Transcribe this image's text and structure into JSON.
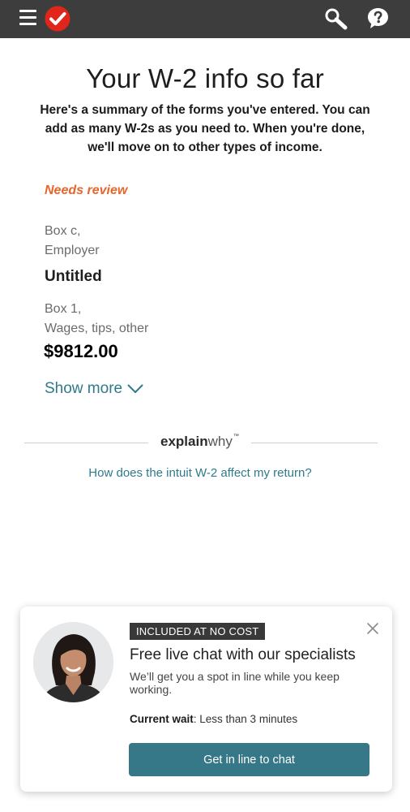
{
  "header": {
    "menu_icon": "hamburger-icon",
    "logo_icon": "checkmark-logo-icon",
    "search_icon": "search-icon",
    "help_icon": "help-question-icon",
    "brand_color": "#e1251b",
    "bar_color": "#3d3d3d"
  },
  "page": {
    "title": "Your W-2 info so far",
    "subtitle": "Here's a summary of the forms you've entered. You can add as many W-2s as you need to. When you're done, we'll move on to other types of income."
  },
  "w2": {
    "status": "Needs review",
    "employer_label_line1": "Box c,",
    "employer_label_line2": "Employer",
    "employer_value": "Untitled",
    "wages_label_line1": "Box 1,",
    "wages_label_line2": "Wages, tips, other",
    "wages_value": "$9812.00",
    "show_more": "Show more",
    "status_color": "#e8652b",
    "link_color": "#2f7a8c"
  },
  "explain": {
    "logo_bold": "explain",
    "logo_light": "why",
    "logo_mark": "™",
    "link": "How does the intuit W-2 affect my return?"
  },
  "chat": {
    "badge": "INCLUDED AT NO COST",
    "title": "Free live chat with our specialists",
    "description": "We’ll get you a spot in line while you keep working.",
    "wait_label": "Current wait",
    "wait_value": ": Less than 3 minutes",
    "button": "Get in line to chat",
    "button_color": "#367788",
    "close_icon": "close-icon"
  }
}
